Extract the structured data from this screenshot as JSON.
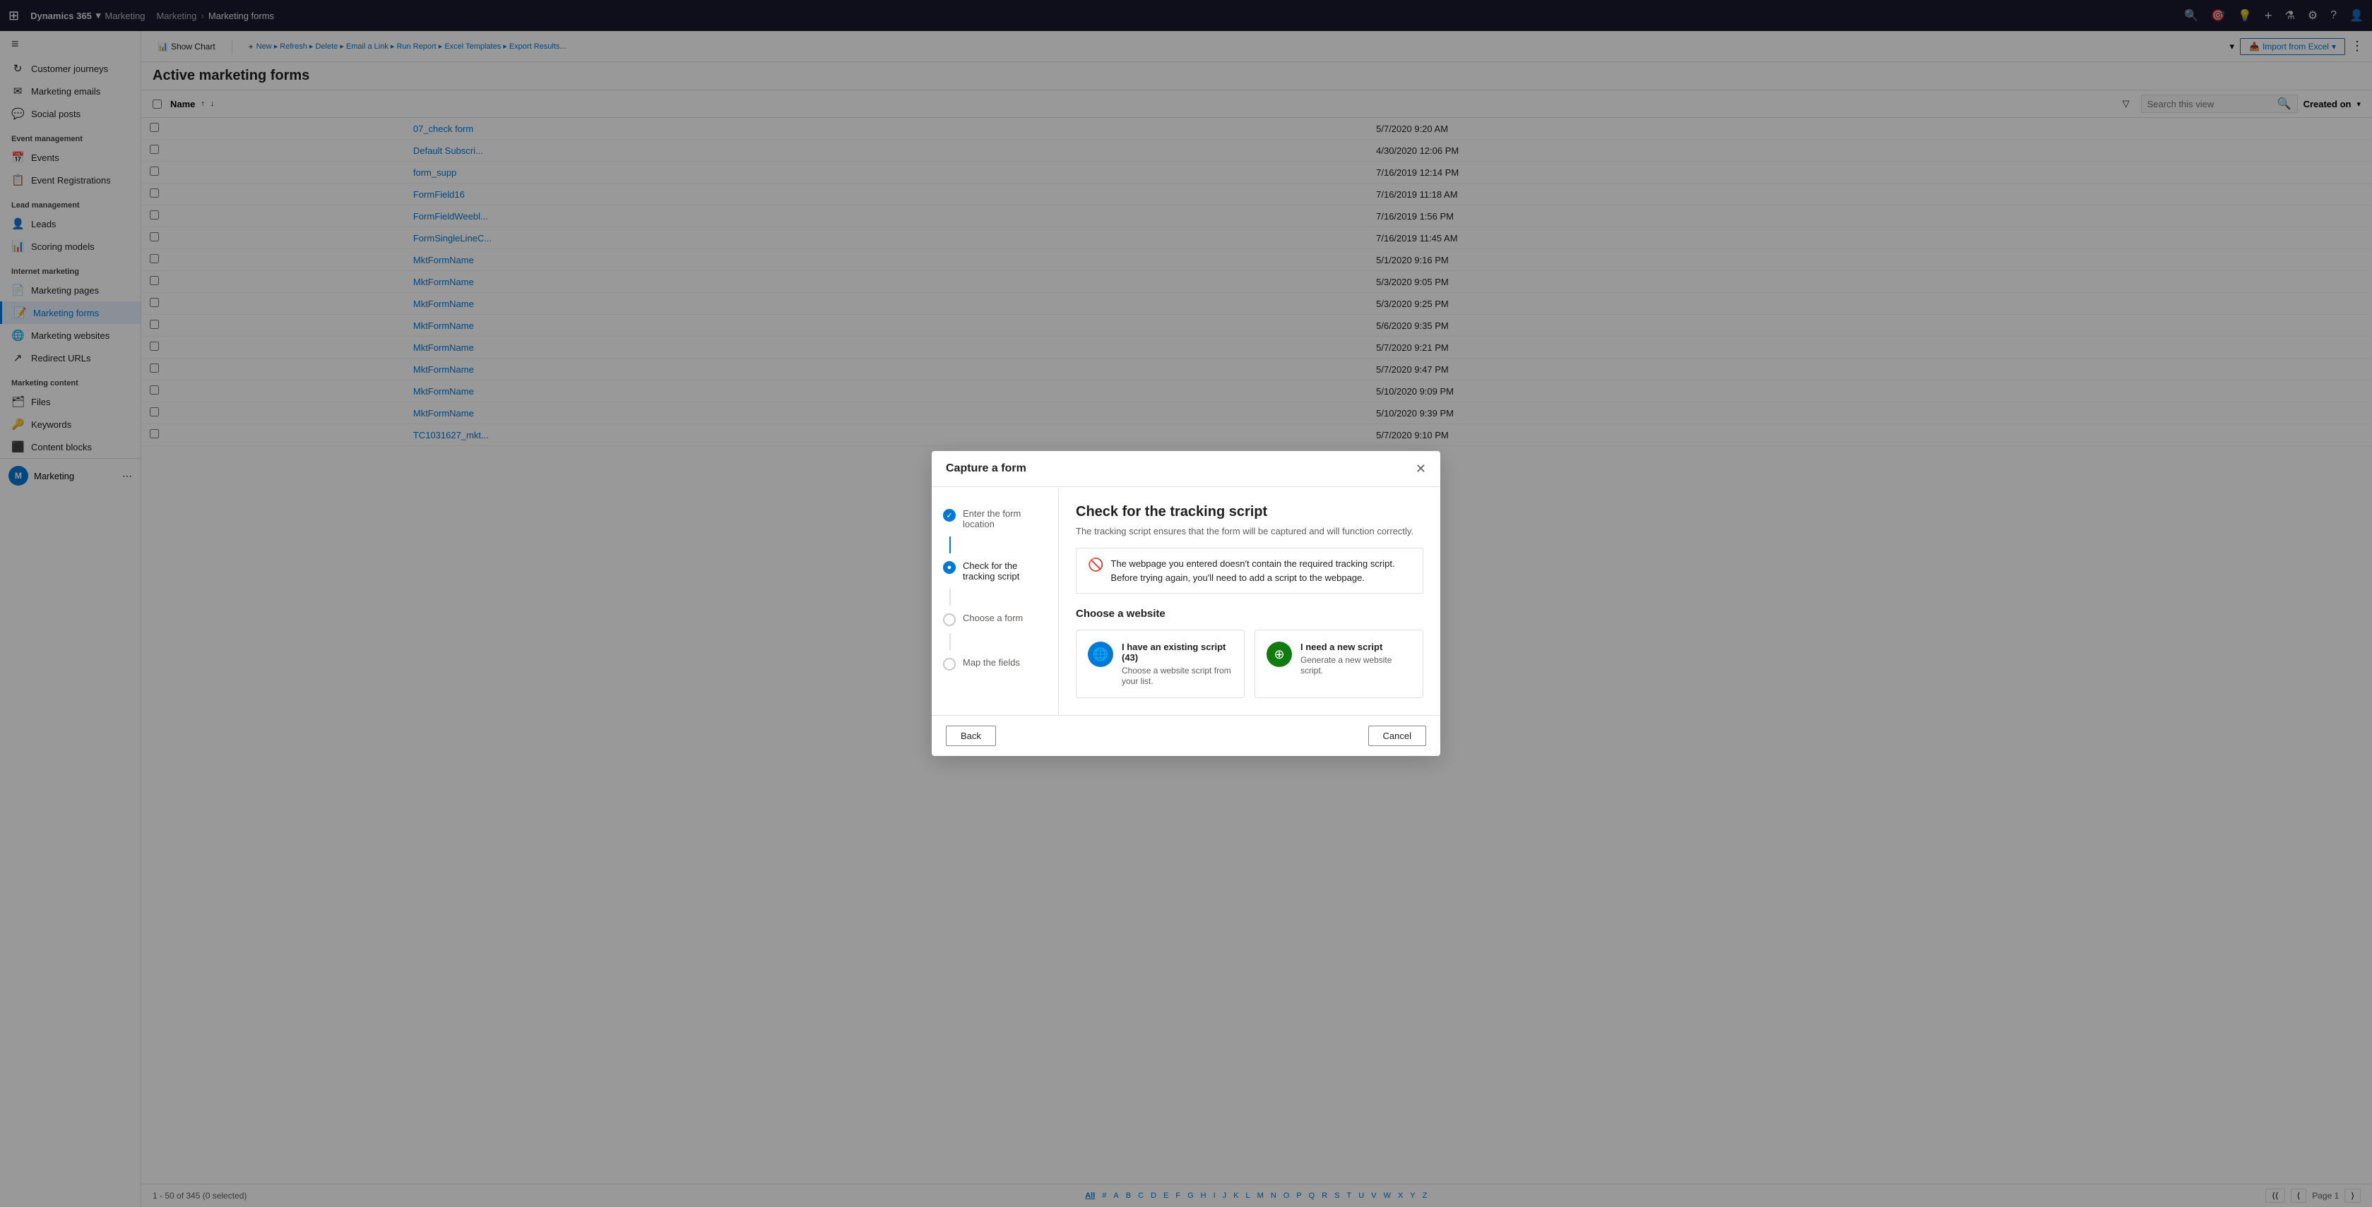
{
  "topNav": {
    "gridIcon": "⊞",
    "brand": "Dynamics 365",
    "module": "Marketing",
    "breadcrumb": [
      "Marketing",
      "Marketing forms"
    ],
    "icons": [
      "🔍",
      "🎯",
      "💡",
      "+",
      "⚗",
      "⚙",
      "?",
      "👤"
    ]
  },
  "sidebar": {
    "collapseIcon": "≡",
    "sections": [
      {
        "label": "",
        "items": [
          {
            "id": "customer-journeys",
            "icon": "↻",
            "label": "Customer journeys"
          },
          {
            "id": "marketing-emails",
            "icon": "✉",
            "label": "Marketing emails"
          },
          {
            "id": "social-posts",
            "icon": "💬",
            "label": "Social posts"
          }
        ]
      },
      {
        "label": "Event management",
        "items": [
          {
            "id": "events",
            "icon": "📅",
            "label": "Events"
          },
          {
            "id": "event-registrations",
            "icon": "📋",
            "label": "Event Registrations"
          }
        ]
      },
      {
        "label": "Lead management",
        "items": [
          {
            "id": "leads",
            "icon": "👤",
            "label": "Leads"
          },
          {
            "id": "scoring-models",
            "icon": "📊",
            "label": "Scoring models"
          }
        ]
      },
      {
        "label": "Internet marketing",
        "items": [
          {
            "id": "marketing-pages",
            "icon": "📄",
            "label": "Marketing pages"
          },
          {
            "id": "marketing-forms",
            "icon": "📝",
            "label": "Marketing forms",
            "active": true
          },
          {
            "id": "marketing-websites",
            "icon": "🌐",
            "label": "Marketing websites"
          },
          {
            "id": "redirect-urls",
            "icon": "↗",
            "label": "Redirect URLs"
          }
        ]
      },
      {
        "label": "Marketing content",
        "items": [
          {
            "id": "files",
            "icon": "🗂",
            "label": "Files"
          },
          {
            "id": "keywords",
            "icon": "🔑",
            "label": "Keywords"
          },
          {
            "id": "content-blocks",
            "icon": "⬛",
            "label": "Content blocks"
          }
        ]
      }
    ],
    "bottomUser": {
      "initials": "M",
      "label": "Marketing"
    }
  },
  "toolbar": {
    "showChartLabel": "Show Chart",
    "showChartIcon": "📊",
    "addIcon": "+",
    "importLabel": "Import from Excel",
    "importIcon": "📥",
    "moreIcon": "⋮",
    "chevronIcon": "▾"
  },
  "listHeader": {
    "title": "Active marke..."
  },
  "tableToolbar": {
    "filterIcon": "▽",
    "searchPlaceholder": "Search this view",
    "searchIcon": "🔍",
    "createdOnLabel": "Created on",
    "nameLabel": "Name"
  },
  "tableRows": [
    {
      "name": "07_check form",
      "date": "5/7/2020 9:20 AM"
    },
    {
      "name": "Default Subscri...",
      "date": "4/30/2020 12:06 PM"
    },
    {
      "name": "form_supp",
      "date": "7/16/2019 12:14 PM"
    },
    {
      "name": "FormField16",
      "date": "7/16/2019 11:18 AM"
    },
    {
      "name": "FormFieldWeebl...",
      "date": "7/16/2019 1:56 PM"
    },
    {
      "name": "FormSingleLineC...",
      "date": "7/16/2019 11:45 AM"
    },
    {
      "name": "MktFormName",
      "date": "5/1/2020 9:16 PM"
    },
    {
      "name": "MktFormName",
      "date": "5/3/2020 9:05 PM"
    },
    {
      "name": "MktFormName",
      "date": "5/3/2020 9:25 PM"
    },
    {
      "name": "MktFormName",
      "date": "5/6/2020 9:35 PM"
    },
    {
      "name": "MktFormName",
      "date": "5/7/2020 9:21 PM"
    },
    {
      "name": "MktFormName",
      "date": "5/7/2020 9:47 PM"
    },
    {
      "name": "MktFormName",
      "date": "5/10/2020 9:09 PM"
    },
    {
      "name": "MktFormName",
      "date": "5/10/2020 9:39 PM"
    },
    {
      "name": "TC1031627_mkt...",
      "date": "5/7/2020 9:10 PM"
    }
  ],
  "pagination": {
    "countLabel": "1 - 50 of 345 (0 selected)",
    "pageLabel": "Page 1",
    "firstIcon": "⟨⟨",
    "prevIcon": "⟨",
    "nextIcon": "⟩",
    "alphaItems": [
      "All",
      "#",
      "A",
      "B",
      "C",
      "D",
      "E",
      "F",
      "G",
      "H",
      "I",
      "J",
      "K",
      "L",
      "M",
      "N",
      "O",
      "P",
      "Q",
      "R",
      "S",
      "T",
      "U",
      "V",
      "W",
      "X",
      "Y",
      "Z"
    ]
  },
  "modal": {
    "title": "Capture a form",
    "closeIcon": "✕",
    "steps": [
      {
        "id": "enter-location",
        "label": "Enter the form location",
        "state": "completed"
      },
      {
        "id": "check-tracking",
        "label": "Check for the tracking script",
        "state": "active"
      },
      {
        "id": "choose-form",
        "label": "Choose a form",
        "state": "pending"
      },
      {
        "id": "map-fields",
        "label": "Map the fields",
        "state": "pending"
      }
    ],
    "content": {
      "title": "Check for the tracking script",
      "description": "The tracking script ensures that the form will be captured and will function correctly.",
      "errorText": "The webpage you entered doesn't contain the required tracking script. Before trying again, you'll need to add a script to the webpage.",
      "errorIcon": "🚫",
      "websiteSectionTitle": "Choose a website",
      "options": [
        {
          "id": "existing-script",
          "iconType": "blue",
          "iconChar": "🌐",
          "label": "I have an existing script (43)",
          "desc": "Choose a website script from your list."
        },
        {
          "id": "new-script",
          "iconType": "green",
          "iconChar": "⊕",
          "label": "I need a new script",
          "desc": "Generate a new website script."
        }
      ]
    },
    "footer": {
      "backLabel": "Back",
      "cancelLabel": "Cancel"
    }
  }
}
